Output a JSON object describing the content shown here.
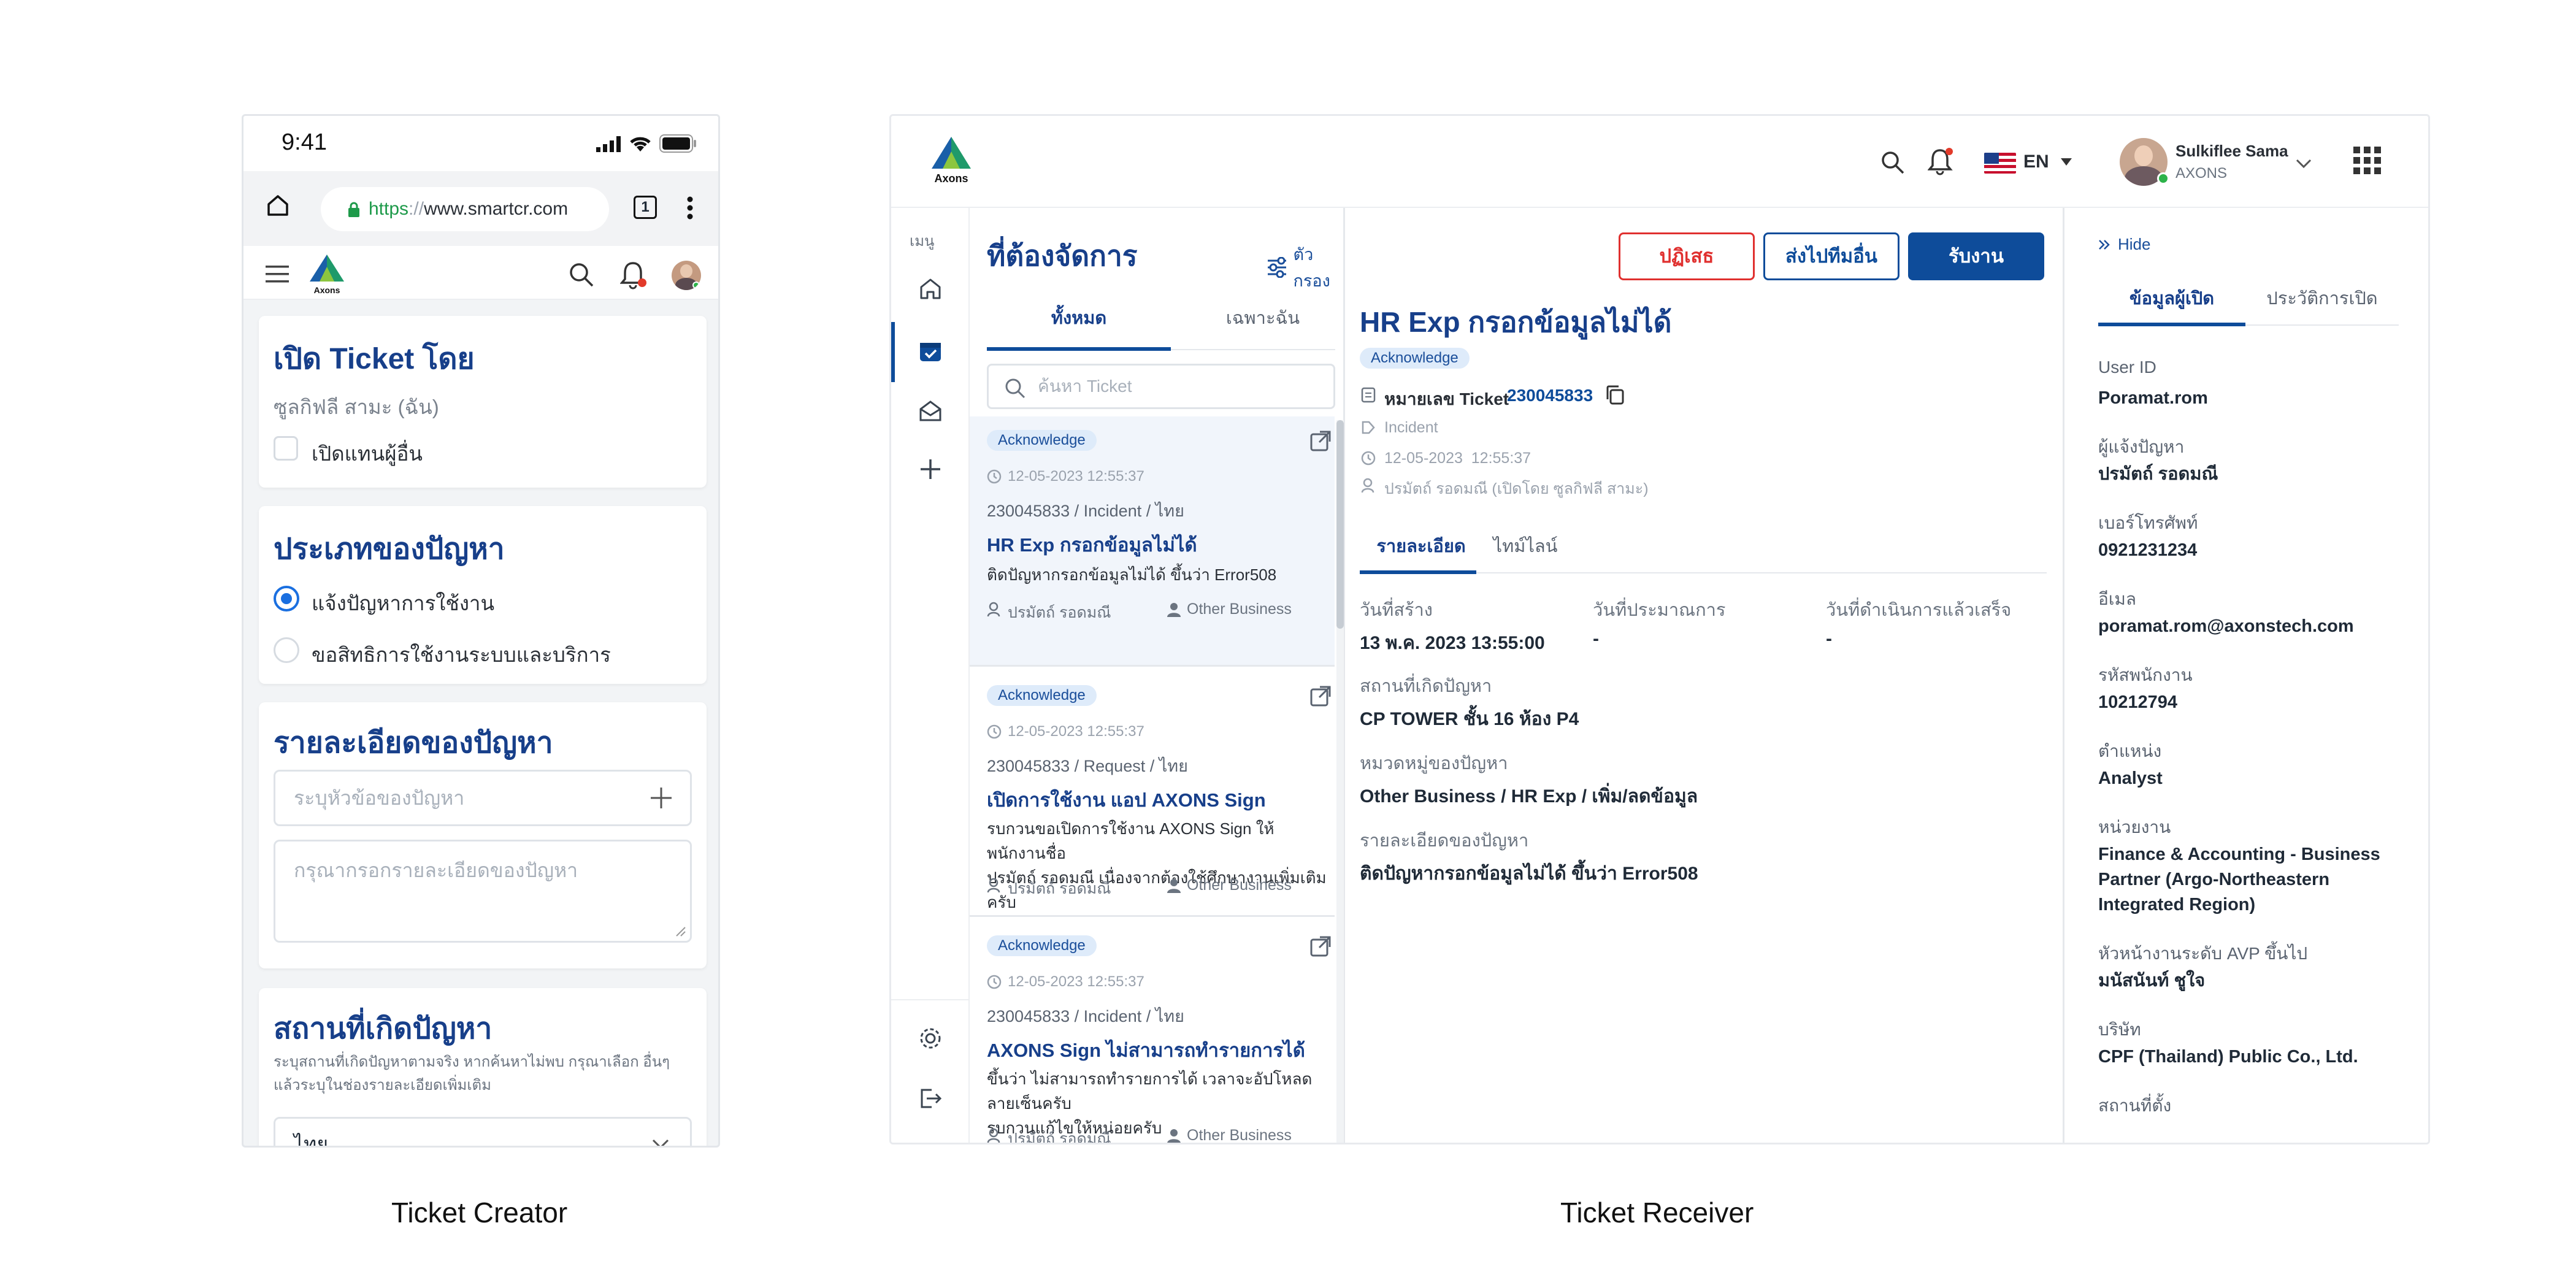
{
  "colors": {
    "navy": "#173f8a",
    "primary": "#0e4c9a",
    "danger": "#e0302f",
    "badge_bg": "#deebfa",
    "bg": "#ffffff"
  },
  "captions": {
    "creator": "Ticket Creator",
    "receiver": "Ticket Receiver"
  },
  "mobile": {
    "status_time": "9:41",
    "url": {
      "scheme": "https",
      "sep": "://",
      "host": "www.smartcr.com"
    },
    "tab_count": "1",
    "logo_text": "Axons",
    "section_open": {
      "title": "เปิด Ticket โดย",
      "user": "ซูลกิฟลี สามะ (ฉัน)",
      "checkbox_label": "เปิดแทนผู้อื่น"
    },
    "section_type": {
      "title": "ประเภทของปัญหา",
      "options": [
        "แจ้งปัญหาการใช้งาน",
        "ขอสิทธิการใช้งานระบบและบริการ"
      ],
      "selected": 0
    },
    "section_detail": {
      "title": "รายละเอียดของปัญหา",
      "subject_placeholder": "ระบุหัวข้อของปัญหา",
      "detail_placeholder": "กรุณากรอกรายละเอียดของปัญหา"
    },
    "section_location": {
      "title": "สถานที่เกิดปัญหา",
      "hint_line1": "ระบุสถานที่เกิดปัญหาตามจริง หากค้นหาไม่พบ กรุณาเลือก อื่นๆ",
      "hint_line2": "แล้วระบุในช่องรายละเอียดเพิ่มเติม",
      "selected": "ไทย"
    }
  },
  "desktop": {
    "logo_text": "Axons",
    "lang": "EN",
    "user": {
      "name": "Sulkiflee Sama",
      "org": "AXONS"
    },
    "menu_label": "เมนู",
    "list": {
      "title": "ที่ต้องจัดการ",
      "filter_label": "ตัวกรอง",
      "tabs": [
        "ทั้งหมด",
        "เฉพาะฉัน"
      ],
      "active_tab": 0,
      "search_placeholder": "ค้นหา Ticket",
      "tickets": [
        {
          "status": "Acknowledge",
          "datetime": "12-05-2023 12:55:37",
          "id_line": "230045833 / Incident / ไทย",
          "title": "HR Exp กรอกข้อมูลไม่ได้",
          "desc": [
            "ติดปัญหากรอกข้อมูลไม่ได้ ขึ้นว่า Error508"
          ],
          "reporter": "ปรมัตถ์ รอดมณี",
          "business": "Other Business"
        },
        {
          "status": "Acknowledge",
          "datetime": "12-05-2023 12:55:37",
          "id_line": "230045833 / Request / ไทย",
          "title": "เปิดการใช้งาน แอป AXONS Sign",
          "desc": [
            "รบกวนขอเปิดการใช้งาน AXONS Sign ให้พนักงานชื่อ",
            "ปรมัตถ์ รอดมณี เนื่องจากต้องใช้ศึกษางานเพิ่มเติมครับ"
          ],
          "reporter": "ปรมัตถ์ รอดมณี",
          "business": "Other Business"
        },
        {
          "status": "Acknowledge",
          "datetime": "12-05-2023 12:55:37",
          "id_line": "230045833 / Incident / ไทย",
          "title": "AXONS Sign ไม่สามารถทำรายการได้",
          "desc": [
            "ขึ้นว่า ไม่สามารถทำรายการได้ เวลาจะอัปโหลดลายเซ็นครับ",
            "รบกวนแก้ไขให้หน่อยครับ"
          ],
          "reporter": "ปรมัตถ์ รอดมณี",
          "business": "Other Business"
        }
      ]
    },
    "detail": {
      "buttons": {
        "reject": "ปฏิเสธ",
        "forward": "ส่งไปทีมอื่น",
        "accept": "รับงาน"
      },
      "title": "HR Exp กรอกข้อมูลไม่ได้",
      "status": "Acknowledge",
      "ticket_no_label": "หมายเลข Ticket",
      "ticket_no": "230045833",
      "category": "Incident",
      "datetime": "12-05-2023  12:55:37",
      "opened_by": "ปรมัตถ์ รอดมณี (เปิดโดย ซูลกิฟลี สามะ)",
      "tabs": [
        "รายละเอียด",
        "ไทม์ไลน์"
      ],
      "active_tab": 0,
      "fields": {
        "created_label": "วันที่สร้าง",
        "created": "13 พ.ค. 2023 13:55:00",
        "estimate_label": "วันที่ประมาณการ",
        "estimate": "-",
        "done_label": "วันที่ดำเนินการแล้วเสร็จ",
        "done": "-",
        "location_label": "สถานที่เกิดปัญหา",
        "location": "CP TOWER ชั้น 16 ห้อง P4",
        "category_label": "หมวดหมู่ของปัญหา",
        "category": "Other Business / HR Exp / เพิ่ม/ลดข้อมูล",
        "detail_label": "รายละเอียดของปัญหา",
        "detail": "ติดปัญหากรอกข้อมูลไม่ได้ ขึ้นว่า Error508"
      }
    },
    "info": {
      "hide_label": "Hide",
      "tabs": [
        "ข้อมูลผู้เปิด",
        "ประวัติการเปิด"
      ],
      "active_tab": 0,
      "user_id_label": "User ID",
      "user_id": "Poramat.rom",
      "reporter_label": "ผู้แจ้งปัญหา",
      "reporter": "ปรมัตถ์ รอดมณี",
      "phone_label": "เบอร์โทรศัพท์",
      "phone": "0921231234",
      "email_label": "อีเมล",
      "email": "poramat.rom@axonstech.com",
      "emp_label": "รหัสพนักงาน",
      "emp": "10212794",
      "position_label": "ตำแหน่ง",
      "position": "Analyst",
      "unit_label": "หน่วยงาน",
      "unit_lines": [
        "Finance & Accounting - Business",
        "Partner (Argo-Northeastern",
        "Integrated Region)"
      ],
      "head_label": "หัวหน้างานระดับ AVP ขึ้นไป",
      "head": "มนัสนันท์ ชูใจ",
      "company_label": "บริษัท",
      "company": "CPF (Thailand) Public Co., Ltd.",
      "site_label": "สถานที่ตั้ง"
    }
  }
}
